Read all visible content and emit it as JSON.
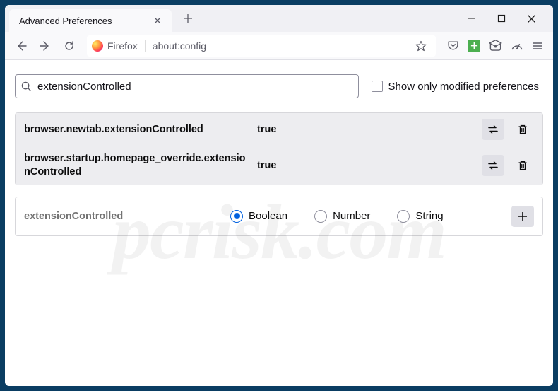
{
  "window": {
    "tab_title": "Advanced Preferences"
  },
  "urlbar": {
    "identity": "Firefox",
    "url": "about:config"
  },
  "page": {
    "search_value": "extensionControlled",
    "checkbox_label": "Show only modified preferences"
  },
  "prefs": [
    {
      "name": "browser.newtab.extensionControlled",
      "value": "true"
    },
    {
      "name": "browser.startup.homepage_override.extensionControlled",
      "value": "true"
    }
  ],
  "add": {
    "name": "extensionControlled",
    "type_boolean": "Boolean",
    "type_number": "Number",
    "type_string": "String",
    "selected": "boolean"
  },
  "watermark": "pcrisk.com"
}
